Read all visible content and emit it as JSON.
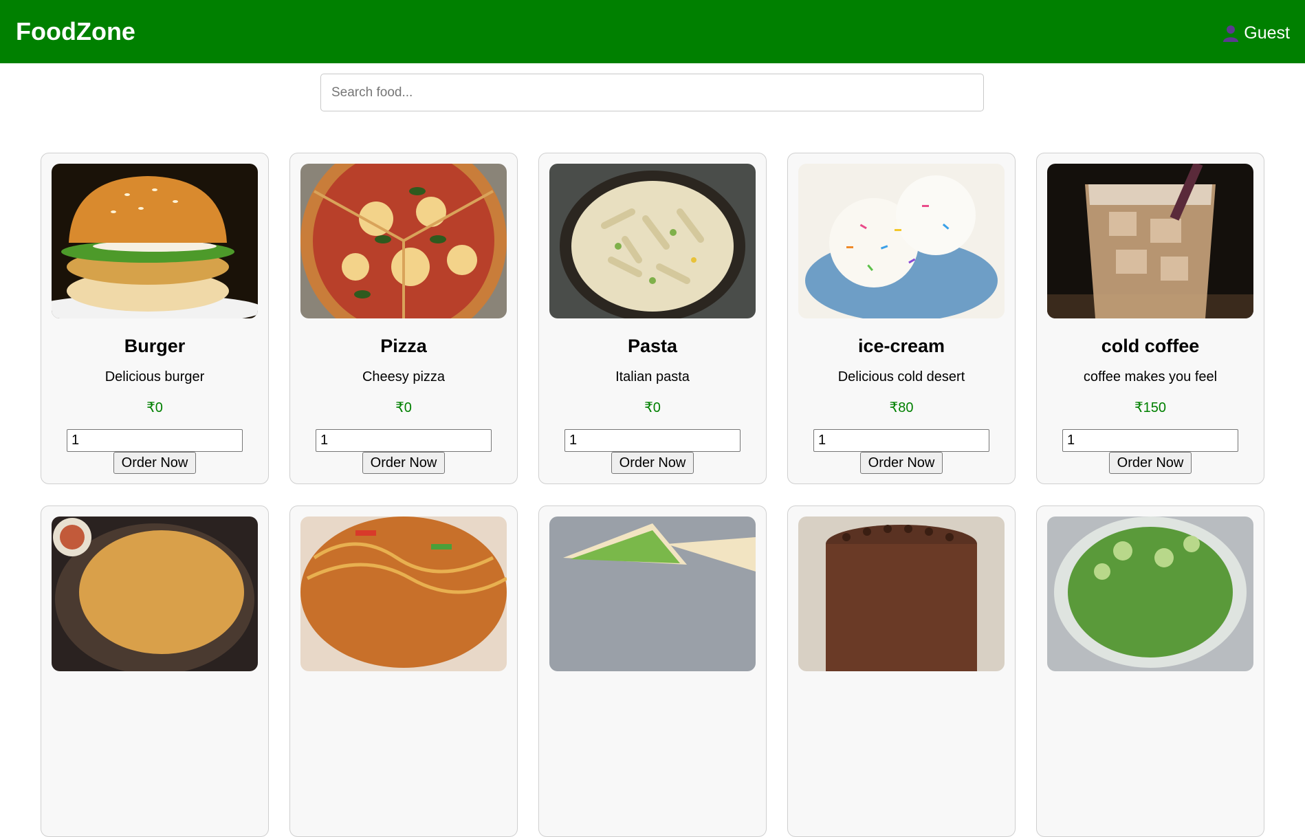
{
  "header": {
    "brand": "FoodZone",
    "user_label": "Guest",
    "user_icon": "user-icon",
    "bg_color": "#008000"
  },
  "search": {
    "placeholder": "Search food...",
    "value": ""
  },
  "order_label": "Order Now",
  "items": [
    {
      "name": "Burger",
      "desc": "Delicious burger",
      "price": "₹0",
      "qty": "1",
      "image": "burger-image"
    },
    {
      "name": "Pizza",
      "desc": "Cheesy pizza",
      "price": "₹0",
      "qty": "1",
      "image": "pizza-image"
    },
    {
      "name": "Pasta",
      "desc": "Italian pasta",
      "price": "₹0",
      "qty": "1",
      "image": "pasta-image"
    },
    {
      "name": "ice-cream",
      "desc": "Delicious cold desert",
      "price": "₹80",
      "qty": "1",
      "image": "ice-cream-image"
    },
    {
      "name": "cold coffee",
      "desc": "coffee makes you feel",
      "price": "₹150",
      "qty": "1",
      "image": "cold-coffee-image"
    },
    {
      "name": "",
      "desc": "",
      "price": "",
      "qty": "",
      "image": "biryani-image"
    },
    {
      "name": "",
      "desc": "",
      "price": "",
      "qty": "",
      "image": "noodles-image"
    },
    {
      "name": "",
      "desc": "",
      "price": "",
      "qty": "",
      "image": "sandwich-image"
    },
    {
      "name": "",
      "desc": "",
      "price": "",
      "qty": "",
      "image": "chocolate-cake-image"
    },
    {
      "name": "",
      "desc": "",
      "price": "",
      "qty": "",
      "image": "salad-image"
    }
  ]
}
